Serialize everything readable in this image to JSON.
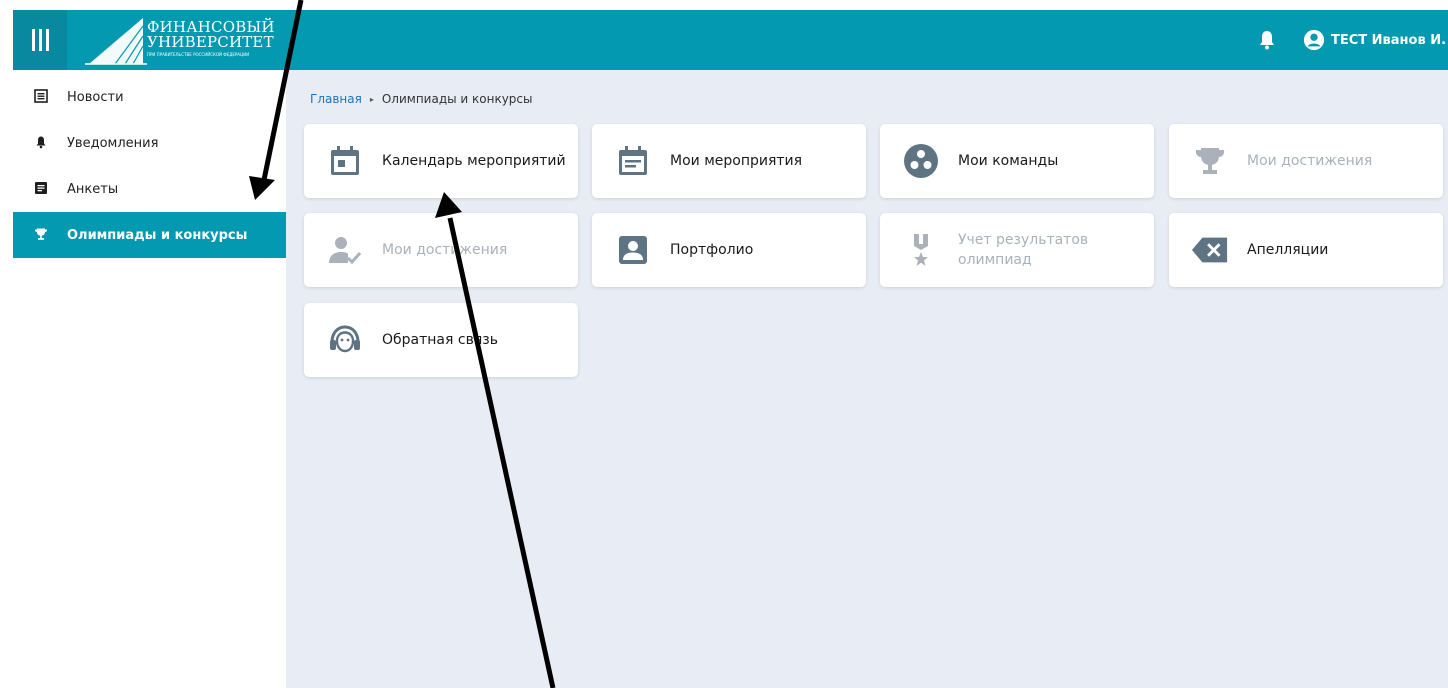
{
  "header": {
    "logo_line1": "ФИНАНСОВЫЙ",
    "logo_line2": "УНИВЕРСИТЕТ",
    "logo_sub": "ПРИ ПРАВИТЕЛЬСТВЕ РОССИЙСКОЙ ФЕДЕРАЦИИ",
    "user_name": "ТЕСТ Иванов И. И."
  },
  "sidebar": {
    "items": [
      {
        "label": "Новости",
        "icon": "newspaper-icon"
      },
      {
        "label": "Уведомления",
        "icon": "bell-icon"
      },
      {
        "label": "Анкеты",
        "icon": "form-icon"
      },
      {
        "label": "Олимпиады и конкурсы",
        "icon": "trophy-icon",
        "active": true
      }
    ]
  },
  "breadcrumb": {
    "home": "Главная",
    "current": "Олимпиады и конкурсы"
  },
  "cards": [
    {
      "label": "Календарь мероприятий",
      "icon": "calendar-icon",
      "enabled": true
    },
    {
      "label": "Мои мероприятия",
      "icon": "event-note-icon",
      "enabled": true
    },
    {
      "label": "Мои команды",
      "icon": "team-icon",
      "enabled": true
    },
    {
      "label": "Мои достижения",
      "icon": "trophy-icon",
      "enabled": false
    },
    {
      "label": "Мои достижения",
      "icon": "user-check-icon",
      "enabled": false
    },
    {
      "label": "Портфолио",
      "icon": "portfolio-icon",
      "enabled": true
    },
    {
      "label": "Учет результатов олимпиад",
      "icon": "medal-icon",
      "enabled": false
    },
    {
      "label": "Апелляции",
      "icon": "backspace-x-icon",
      "enabled": true
    },
    {
      "label": "Обратная связь",
      "icon": "headset-icon",
      "enabled": true
    }
  ],
  "colors": {
    "brand": "#0399b0",
    "brand_dark": "#0889a0",
    "background": "#e8ecf4",
    "icon_active": "#5f7483",
    "icon_disabled": "#aab1ba",
    "link": "#1e73be"
  }
}
